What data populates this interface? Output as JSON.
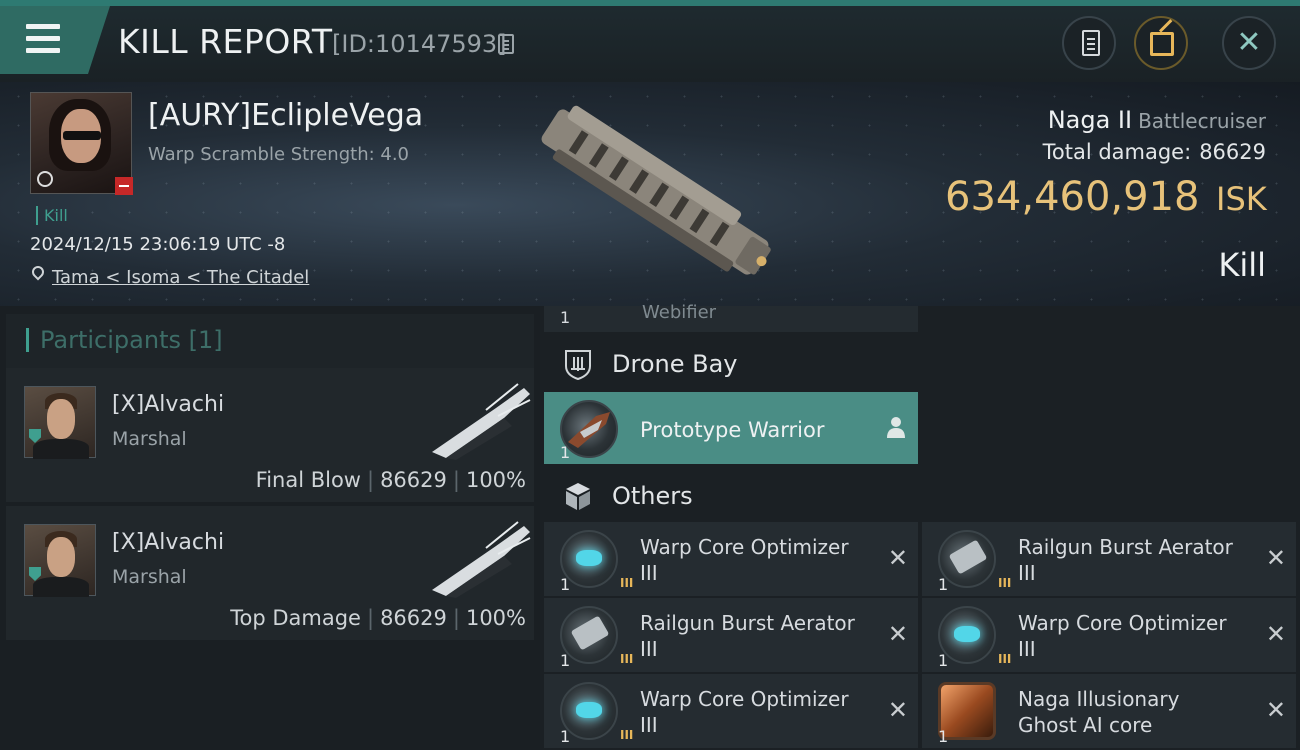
{
  "header": {
    "title": "KILL REPORT",
    "report_id": "[ID:10147593]"
  },
  "victim": {
    "name": "[AURY]EclipleVega",
    "warp_scramble": "Warp Scramble Strength: 4.0",
    "kill_tag": "Kill",
    "timestamp": "2024/12/15 23:06:19 UTC -8",
    "location": "Tama < Isoma < The Citadel"
  },
  "ship": {
    "name": "Naga II",
    "class": "Battlecruiser",
    "total_damage_label": "Total damage:",
    "total_damage": "86629",
    "isk_value": "634,460,918",
    "isk_unit": "ISK",
    "result": "Kill"
  },
  "participants": {
    "title": "Participants [1]",
    "items": [
      {
        "name": "[X]Alvachi",
        "role": "Marshal",
        "label": "Final Blow",
        "damage": "86629",
        "percent": "100%"
      },
      {
        "name": "[X]Alvachi",
        "role": "Marshal",
        "label": "Top Damage",
        "damage": "86629",
        "percent": "100%"
      }
    ]
  },
  "fitting": {
    "webifier": {
      "qty": "1",
      "name": "Webifier"
    },
    "drone_bay": {
      "title": "Drone Bay",
      "item": {
        "qty": "1",
        "name": "Prototype  Warrior"
      }
    },
    "others": {
      "title": "Others",
      "items": [
        {
          "qty": "1",
          "name": "Warp Core Optimizer",
          "tier": "III",
          "icon": "warp-core-optimizer-icon"
        },
        {
          "qty": "1",
          "name": "Railgun Burst Aerator",
          "tier": "III",
          "icon": "railgun-burst-aerator-icon"
        },
        {
          "qty": "1",
          "name": "Railgun Burst Aerator",
          "tier": "III",
          "icon": "railgun-burst-aerator-icon"
        },
        {
          "qty": "1",
          "name": "Warp Core Optimizer",
          "tier": "III",
          "icon": "warp-core-optimizer-icon"
        },
        {
          "qty": "1",
          "name": "Warp Core Optimizer",
          "tier": "III",
          "icon": "warp-core-optimizer-icon"
        },
        {
          "qty": "1",
          "name": "Naga Illusionary",
          "tier": "Ghost AI core",
          "icon": "ghost-ai-core-icon"
        }
      ]
    }
  },
  "colors": {
    "accent": "#3f9f8f",
    "isk": "#e7c27a",
    "drone_highlight": "#4a8d85"
  }
}
